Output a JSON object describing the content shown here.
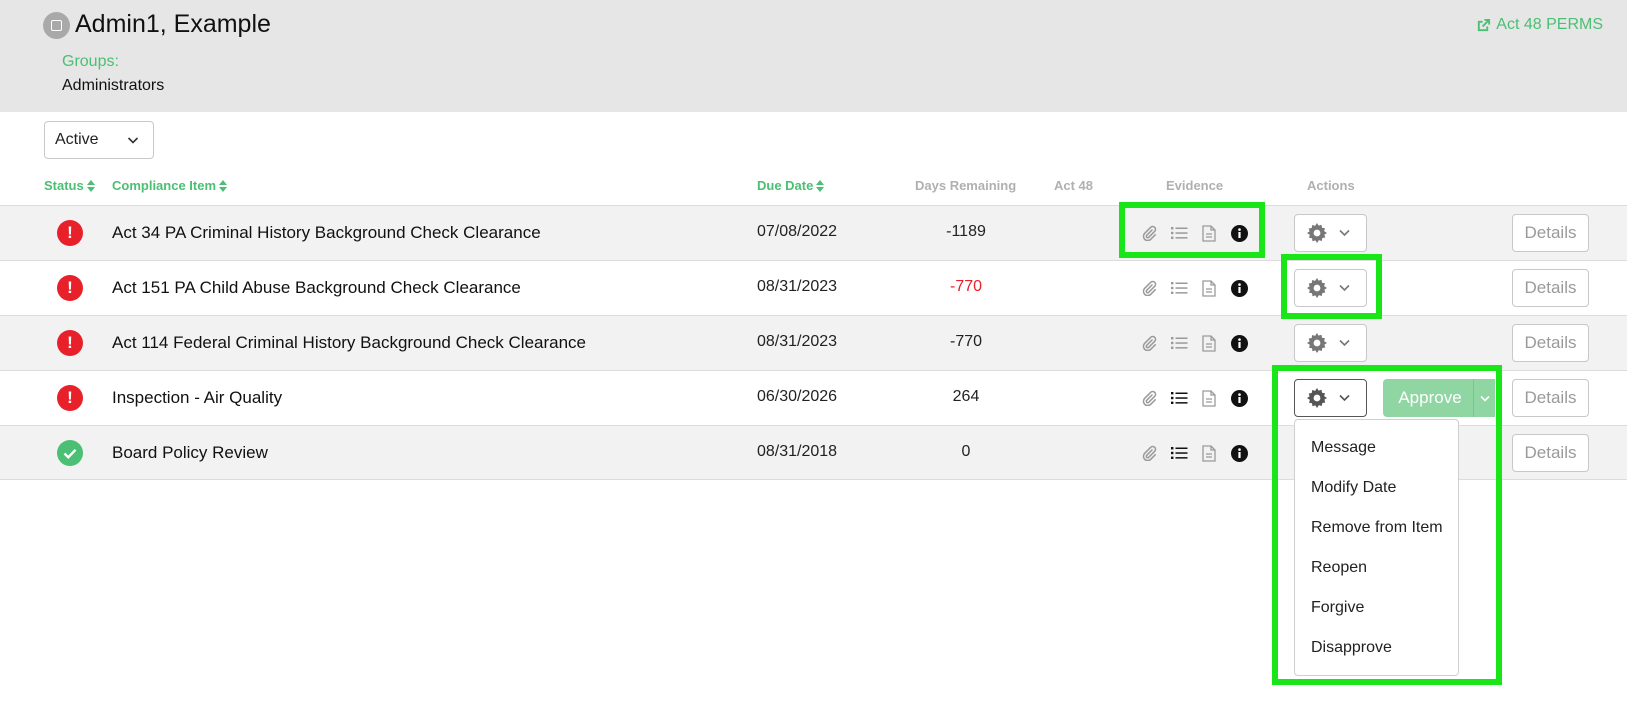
{
  "header": {
    "user_name": "Admin1, Example",
    "act48_link": "Act 48 PERMS",
    "groups_label": "Groups:",
    "groups_value": "Administrators"
  },
  "filter": {
    "selected": "Active"
  },
  "columns": {
    "status": "Status",
    "item": "Compliance Item",
    "due": "Due Date",
    "days": "Days Remaining",
    "act48": "Act 48",
    "evidence": "Evidence",
    "actions": "Actions"
  },
  "rows": [
    {
      "status": "error",
      "item": "Act 34 PA Criminal History Background Check Clearance",
      "due": "07/08/2022",
      "days": "-1189",
      "details": "Details"
    },
    {
      "status": "error",
      "item": "Act 151 PA Child Abuse Background Check Clearance",
      "due": "08/31/2023",
      "days": "-770",
      "details": "Details"
    },
    {
      "status": "error",
      "item": "Act 114 Federal Criminal History Background Check Clearance",
      "due": "08/31/2023",
      "days": "-770",
      "details": "Details"
    },
    {
      "status": "error",
      "item": "Inspection - Air Quality",
      "due": "06/30/2026",
      "days": "264",
      "details": "Details",
      "approve": "Approve"
    },
    {
      "status": "ok",
      "item": "Board Policy Review",
      "due": "08/31/2018",
      "days": "0",
      "details": "Details"
    }
  ],
  "actions_menu": {
    "items": [
      "Message",
      "Modify Date",
      "Remove from Item",
      "Reopen",
      "Forgive",
      "Disapprove"
    ]
  },
  "colors": {
    "accent": "#4bbf73",
    "error": "#e8202a",
    "highlight": "#19e619"
  }
}
